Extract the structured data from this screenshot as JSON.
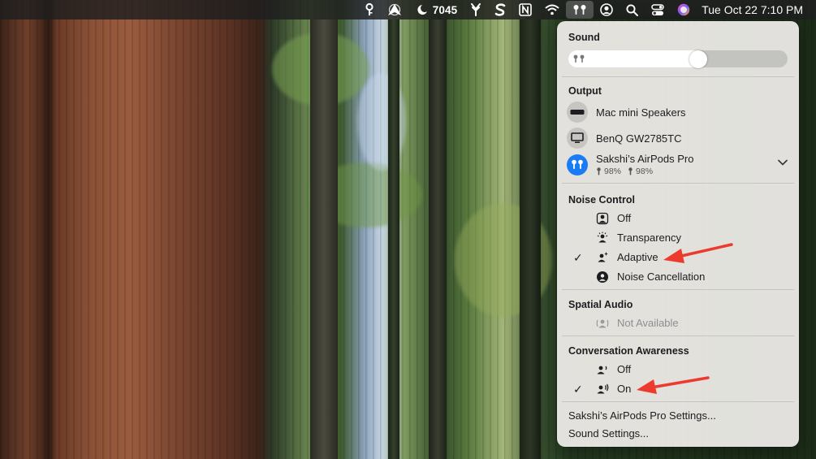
{
  "menubar": {
    "steps_count": "7045",
    "clock": "Tue Oct 22  7:10 PM",
    "icons": [
      "key-icon",
      "location-arrow-icon",
      "moon-icon",
      "steps-icon",
      "fork-icon",
      "scrivener-icon",
      "notion-icon",
      "wifi-icon",
      "airpods-icon",
      "user-icon",
      "search-icon",
      "control-center-icon",
      "siri-icon"
    ]
  },
  "panel": {
    "sound": {
      "title": "Sound",
      "volume_percent": 60
    },
    "output": {
      "title": "Output",
      "devices": [
        {
          "label": "Mac mini Speakers",
          "icon": "mac-mini-icon"
        },
        {
          "label": "BenQ GW2785TC",
          "icon": "display-icon"
        },
        {
          "label": "Sakshi’s AirPods Pro",
          "icon": "airpods-icon",
          "battery_left": "98%",
          "battery_right": "98%",
          "active": true
        }
      ]
    },
    "noise_control": {
      "title": "Noise Control",
      "options": [
        {
          "label": "Off",
          "icon": "noise-off-icon"
        },
        {
          "label": "Transparency",
          "icon": "transparency-icon"
        },
        {
          "label": "Adaptive",
          "icon": "adaptive-icon",
          "checked": true
        },
        {
          "label": "Noise Cancellation",
          "icon": "noise-cancellation-icon"
        }
      ]
    },
    "spatial_audio": {
      "title": "Spatial Audio",
      "status": "Not Available"
    },
    "conversation_awareness": {
      "title": "Conversation Awareness",
      "options": [
        {
          "label": "Off",
          "icon": "conversation-off-icon"
        },
        {
          "label": "On",
          "icon": "conversation-on-icon",
          "checked": true
        }
      ]
    },
    "links": {
      "airpods_settings": "Sakshi’s AirPods Pro Settings...",
      "sound_settings": "Sound Settings..."
    },
    "checkmark": "✓"
  },
  "colors": {
    "accent_blue": "#1a7cf4",
    "annotation_red": "#ec3b2e"
  }
}
